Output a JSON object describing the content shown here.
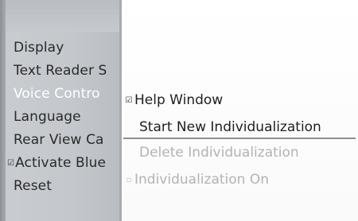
{
  "left_menu": {
    "items": [
      {
        "label": "Display",
        "mark": ""
      },
      {
        "label": "Text Reader S",
        "mark": ""
      },
      {
        "label": "Voice Contro",
        "mark": ""
      },
      {
        "label": "Language",
        "mark": ""
      },
      {
        "label": "Rear View Ca",
        "mark": ""
      },
      {
        "label": "Activate Blue",
        "mark": "☑"
      },
      {
        "label": "Reset",
        "mark": ""
      }
    ],
    "highlighted_index": 2
  },
  "submenu": {
    "items": [
      {
        "label": "Help Window",
        "mark": "☑",
        "state": "normal"
      },
      {
        "label": "Start New Individualization",
        "mark": "",
        "state": "selected"
      },
      {
        "label": "Delete Individualization",
        "mark": "",
        "state": "disabled"
      },
      {
        "label": "Individualization On",
        "mark": "▫",
        "state": "disabled"
      }
    ]
  },
  "colors": {
    "left_panel": "#c4c7cb",
    "highlight_text": "#ffffff",
    "disabled_text": "#b3b3b3"
  }
}
